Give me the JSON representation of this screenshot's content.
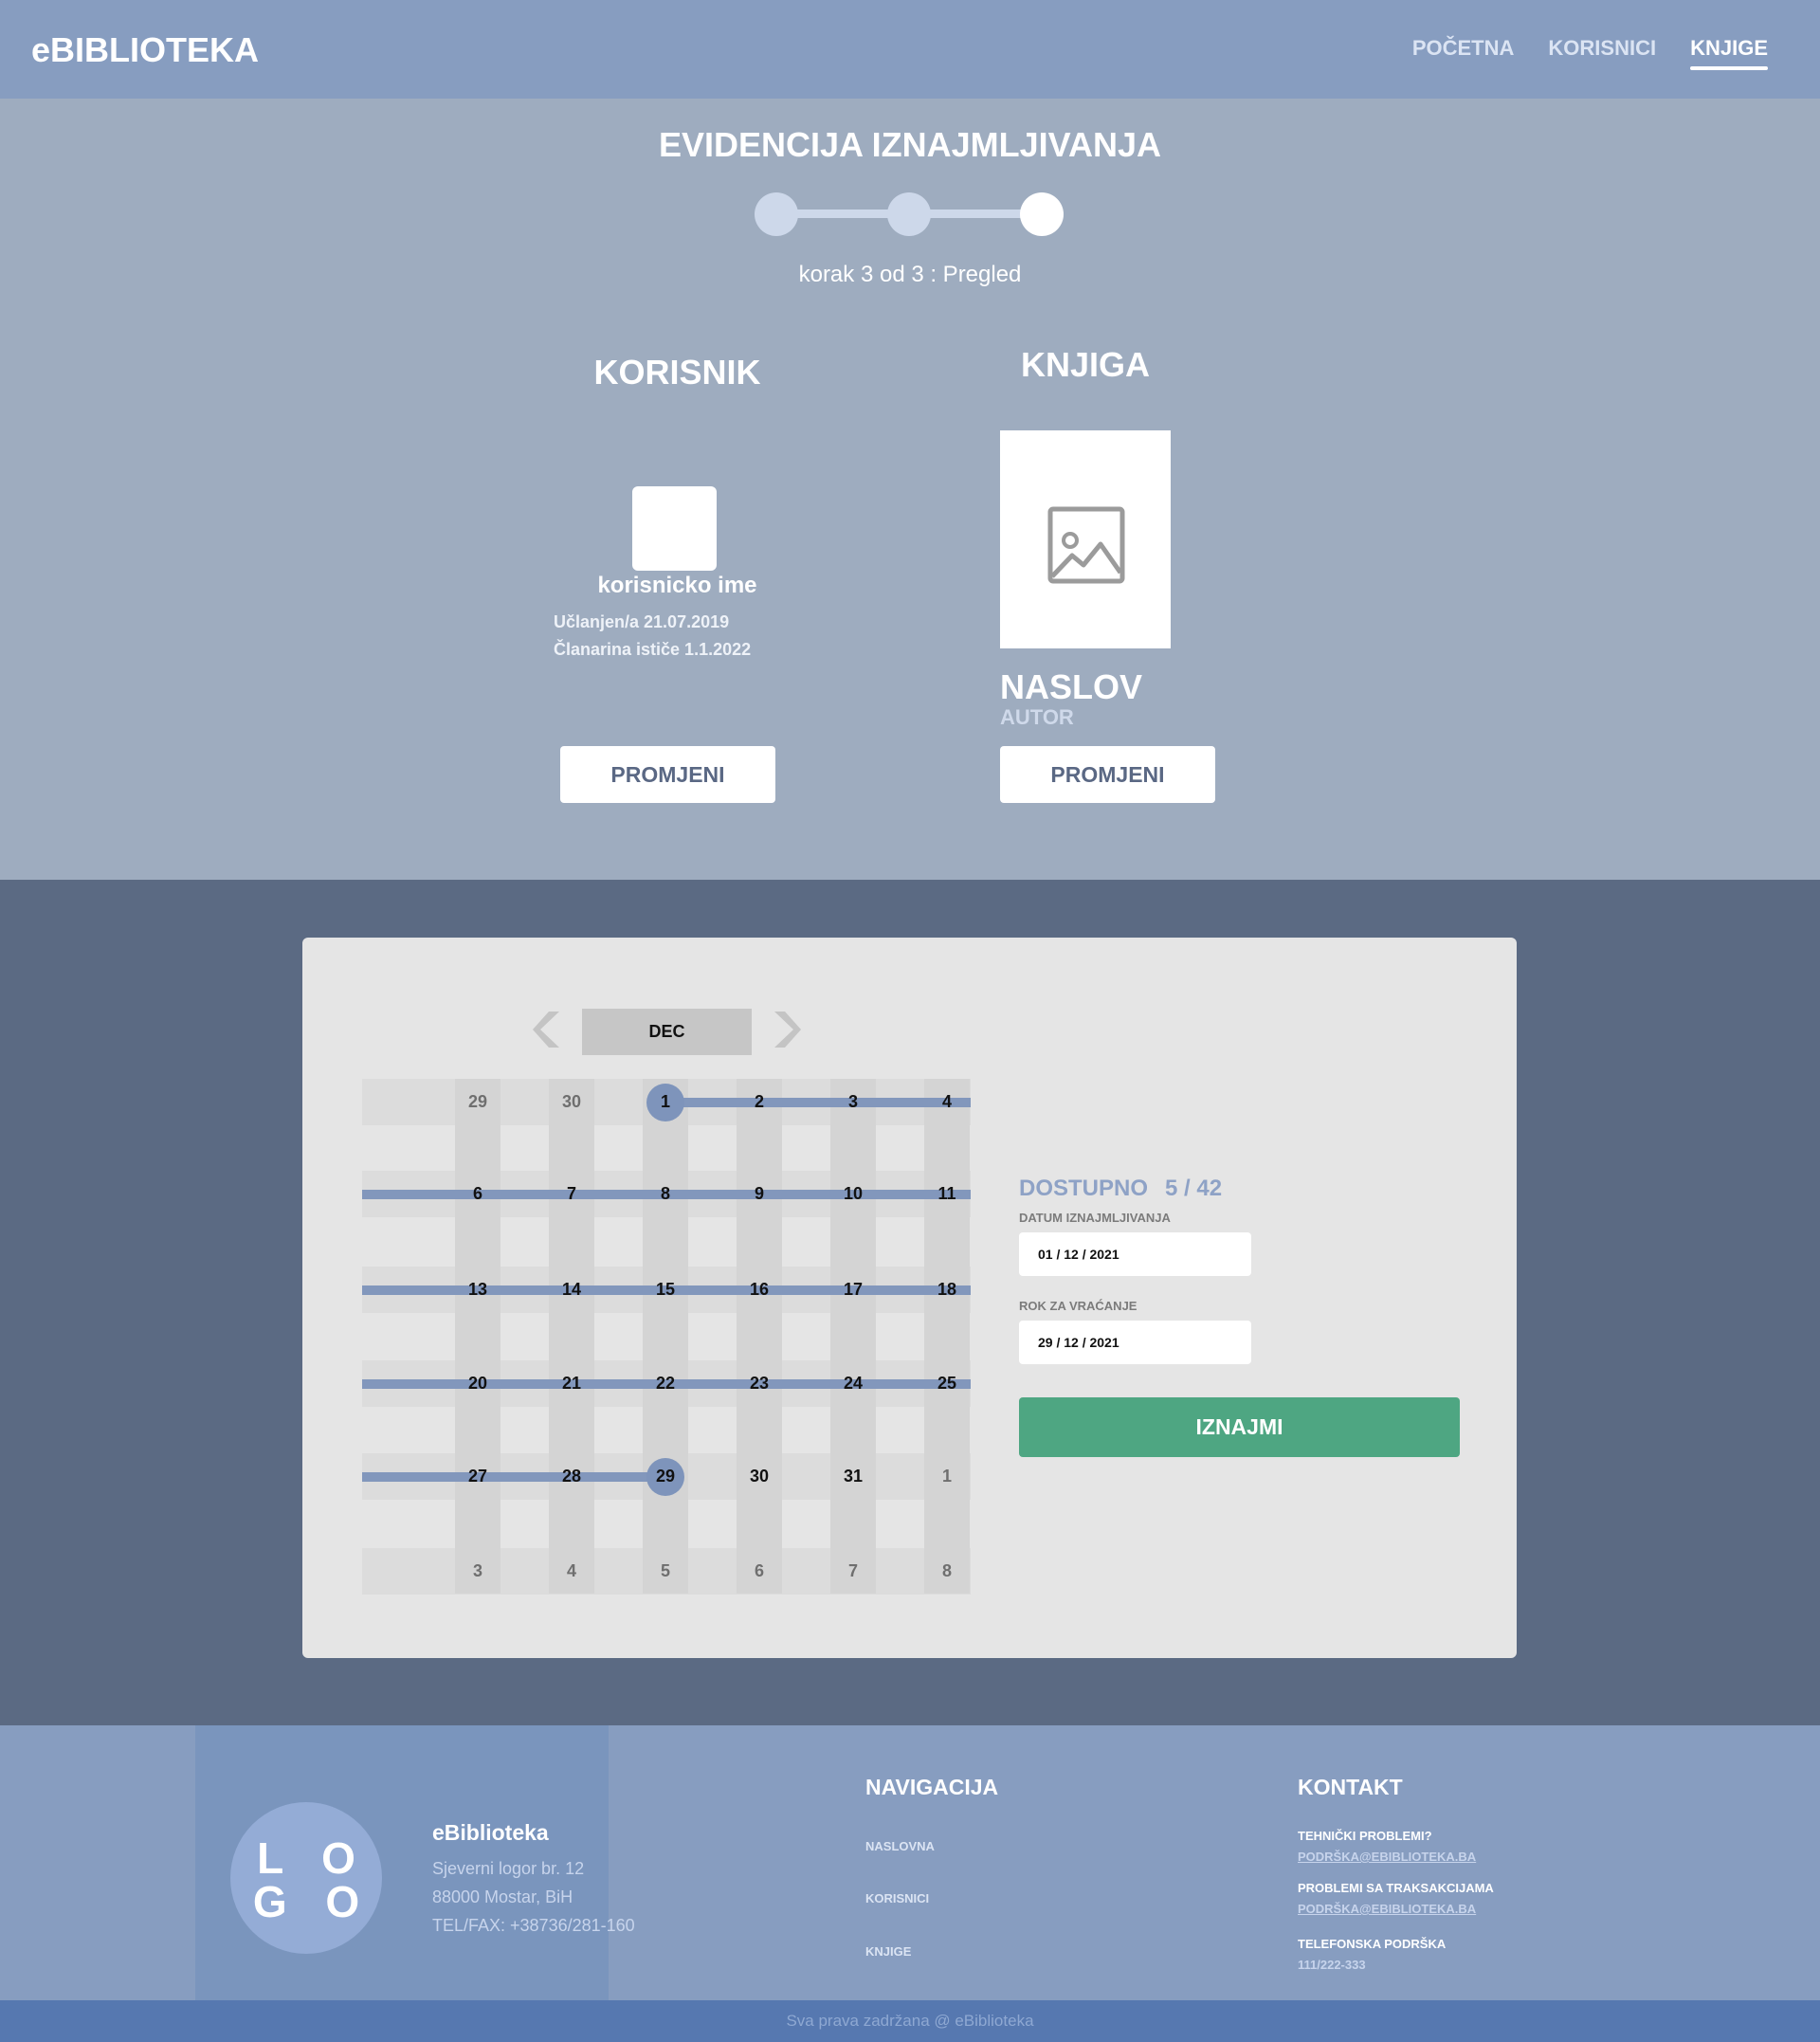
{
  "header": {
    "brand": "eBIBLIOTEKA",
    "nav": [
      "POČETNA",
      "KORISNICI",
      "KNJIGE"
    ],
    "active_nav": "KNJIGE"
  },
  "wizard": {
    "title": "EVIDENCIJA IZNAJMLJIVANJA",
    "current_step": 3,
    "total_steps": 3,
    "step_text": "korak 3 od 3 : Pregled"
  },
  "user": {
    "heading": "KORISNIK",
    "username": "korisnicko ime",
    "joined": "Učlanjen/a 21.07.2019",
    "expires": "Članarina ističe 1.1.2022",
    "change_label": "PROMJENI"
  },
  "book": {
    "heading": "KNJIGA",
    "title": "NASLOV",
    "author": "AUTOR",
    "change_label": "PROMJENI"
  },
  "calendar": {
    "month": "DEC",
    "weeks": [
      [
        {
          "d": "29",
          "o": true
        },
        {
          "d": "30",
          "o": true
        },
        {
          "d": "1"
        },
        {
          "d": "2"
        },
        {
          "d": "3"
        },
        {
          "d": "4"
        }
      ],
      [
        {
          "d": "6"
        },
        {
          "d": "7"
        },
        {
          "d": "8"
        },
        {
          "d": "9"
        },
        {
          "d": "10"
        },
        {
          "d": "11"
        }
      ],
      [
        {
          "d": "13"
        },
        {
          "d": "14"
        },
        {
          "d": "15"
        },
        {
          "d": "16"
        },
        {
          "d": "17"
        },
        {
          "d": "18"
        }
      ],
      [
        {
          "d": "20"
        },
        {
          "d": "21"
        },
        {
          "d": "22"
        },
        {
          "d": "23"
        },
        {
          "d": "24"
        },
        {
          "d": "25"
        }
      ],
      [
        {
          "d": "27"
        },
        {
          "d": "28"
        },
        {
          "d": "29"
        },
        {
          "d": "30"
        },
        {
          "d": "31"
        },
        {
          "d": "1",
          "o": true
        }
      ],
      [
        {
          "d": "3",
          "o": true
        },
        {
          "d": "4",
          "o": true
        },
        {
          "d": "5",
          "o": true
        },
        {
          "d": "6",
          "o": true
        },
        {
          "d": "7",
          "o": true
        },
        {
          "d": "8",
          "o": true
        }
      ]
    ],
    "range_start": "1",
    "range_end": "29"
  },
  "rental": {
    "available_label": "DOSTUPNO",
    "available_count": "5 / 42",
    "date_label": "DATUM IZNAJMLJIVANJA",
    "date_value": "01 / 12 / 2021",
    "return_label": "ROK ZA VRAĆANJE",
    "return_value": "29 / 12 / 2021",
    "submit_label": "IZNAJMI"
  },
  "footer": {
    "logo_text": [
      "L O",
      "G O"
    ],
    "name": "eBiblioteka",
    "address1": "Sjeverni logor br. 12",
    "address2": "88000 Mostar, BiH",
    "phone": "TEL/FAX: +38736/281-160",
    "nav_heading": "NAVIGACIJA",
    "nav_items": [
      "NASLOVNA",
      "KORISNICI",
      "KNJIGE"
    ],
    "contact_heading": "KONTAKT",
    "contacts": [
      {
        "title": "TEHNIČKI PROBLEMI?",
        "value": "PODRŠKA@EBIBLIOTEKA.BA"
      },
      {
        "title": "PROBLEMI SA TRAKSAKCIJAMA",
        "value": "PODRŠKA@EBIBLIOTEKA.BA"
      },
      {
        "title": "TELEFONSKA PODRŠKA",
        "value": "111/222-333"
      }
    ],
    "copyright": "Sva prava zadržana @ eBiblioteka"
  },
  "colors": {
    "header": "#879dc0",
    "accent": "#8297bc",
    "rent_button": "#4ea682",
    "dark_band": "#5b6a83"
  }
}
